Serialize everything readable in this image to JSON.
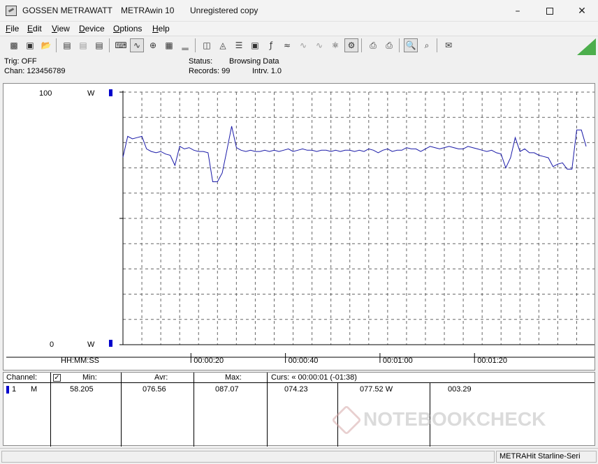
{
  "window": {
    "app_name": "GOSSEN METRAWATT",
    "product": "METRAwin 10",
    "license": "Unregistered copy"
  },
  "menu": [
    "File",
    "Edit",
    "View",
    "Device",
    "Options",
    "Help"
  ],
  "info": {
    "trig": "Trig: OFF",
    "chan": "Chan:  123456789",
    "status_label": "Status:",
    "status_value": "Browsing Data",
    "records": "Records: 99",
    "interval": "Intrv. 1.0"
  },
  "chart_data": {
    "type": "line",
    "y_top_label": "100",
    "y_bottom_label": "0",
    "unit": "W",
    "ylim": [
      0,
      100
    ],
    "x_axis_label": "HH:MM:SS",
    "x_tick_labels": [
      "00:00:20",
      "00:00:40",
      "00:01:00",
      "00:01:20"
    ],
    "grid": true,
    "series_color": "#1a1aa8",
    "series": [
      {
        "values": [
          74.2,
          82.5,
          81.5,
          82,
          82.5,
          77.5,
          76.5,
          76,
          76.5,
          75.5,
          75,
          71,
          78.5,
          77.5,
          78,
          77,
          76.5,
          76.5,
          76,
          64.5,
          64.5,
          68,
          77,
          86.5,
          78,
          77,
          76.5,
          77,
          76.5,
          76.5,
          77,
          76.5,
          77,
          76.5,
          77,
          77.5,
          76.5,
          77,
          77.5,
          77,
          77,
          76.5,
          77,
          77,
          76.5,
          77,
          76.5,
          77,
          77,
          76.5,
          77,
          76.5,
          77.5,
          77,
          76,
          77,
          77.5,
          76.5,
          77,
          77,
          78,
          77.5,
          77.5,
          76.5,
          77.5,
          78.5,
          78,
          77.5,
          78,
          78.5,
          78,
          77.5,
          77.5,
          78.5,
          78,
          77.5,
          77,
          76.5,
          77,
          76,
          75.5,
          70,
          74,
          82,
          76.5,
          77.5,
          76,
          76,
          75,
          74.5,
          74,
          70.5,
          71.5,
          72,
          69.5,
          69.5,
          85,
          85,
          78.5
        ]
      }
    ]
  },
  "table": {
    "headers": {
      "channel": "Channel:",
      "min": "Min:",
      "avr": "Avr:",
      "max": "Max:",
      "curs": "Curs: « 00:00:01 (-01:38)"
    },
    "row": {
      "ch": "1",
      "mode": "M",
      "min": "58.205",
      "avr": "076.56",
      "max": "087.07",
      "c1": "074.23",
      "c2": "077.52   W",
      "c3": "003.29"
    }
  },
  "statusbar": {
    "device": "METRAHit Starline-Seri"
  },
  "watermark": "NOTEBOOKCHECK",
  "icons": [
    "open-icon",
    "save-icon",
    "print-icon",
    "zoom-icon",
    "measure-icon"
  ]
}
